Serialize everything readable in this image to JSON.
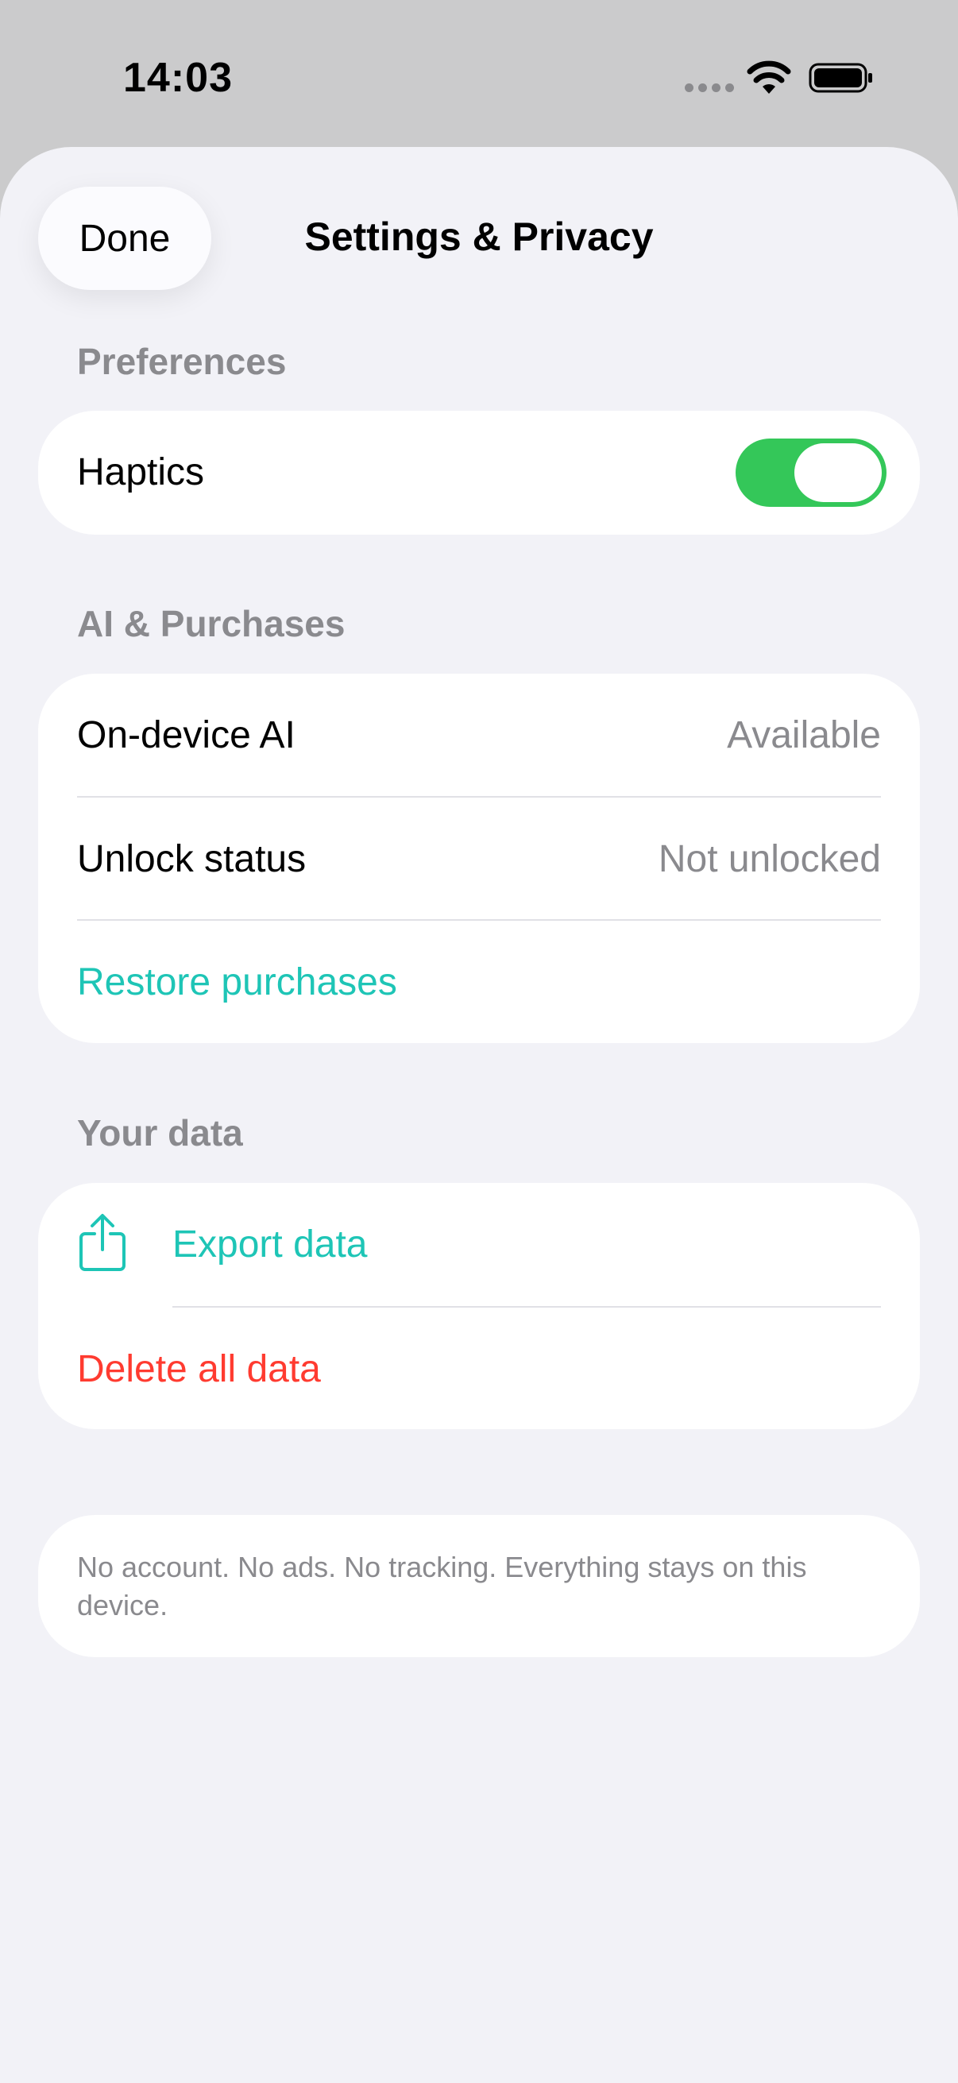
{
  "status_bar": {
    "time": "14:03",
    "icons": [
      "cellular-icon",
      "wifi-icon",
      "battery-icon"
    ]
  },
  "header": {
    "done_label": "Done",
    "title": "Settings & Privacy"
  },
  "sections": {
    "preferences": {
      "header": "Preferences",
      "haptics_label": "Haptics",
      "haptics_enabled": true
    },
    "ai_purchases": {
      "header": "AI & Purchases",
      "on_device_ai_label": "On-device AI",
      "on_device_ai_value": "Available",
      "unlock_status_label": "Unlock status",
      "unlock_status_value": "Not unlocked",
      "restore_label": "Restore purchases"
    },
    "your_data": {
      "header": "Your data",
      "export_label": "Export data",
      "export_icon": "share-icon",
      "delete_label": "Delete all data"
    }
  },
  "footer_note": "No account. No ads. No tracking. Everything stays on this device.",
  "colors": {
    "accent": "#1ec5b6",
    "destructive": "#ff3b30",
    "toggle_on": "#34c759",
    "secondary_text": "#8a8a8e",
    "background": "#f2f2f7"
  }
}
